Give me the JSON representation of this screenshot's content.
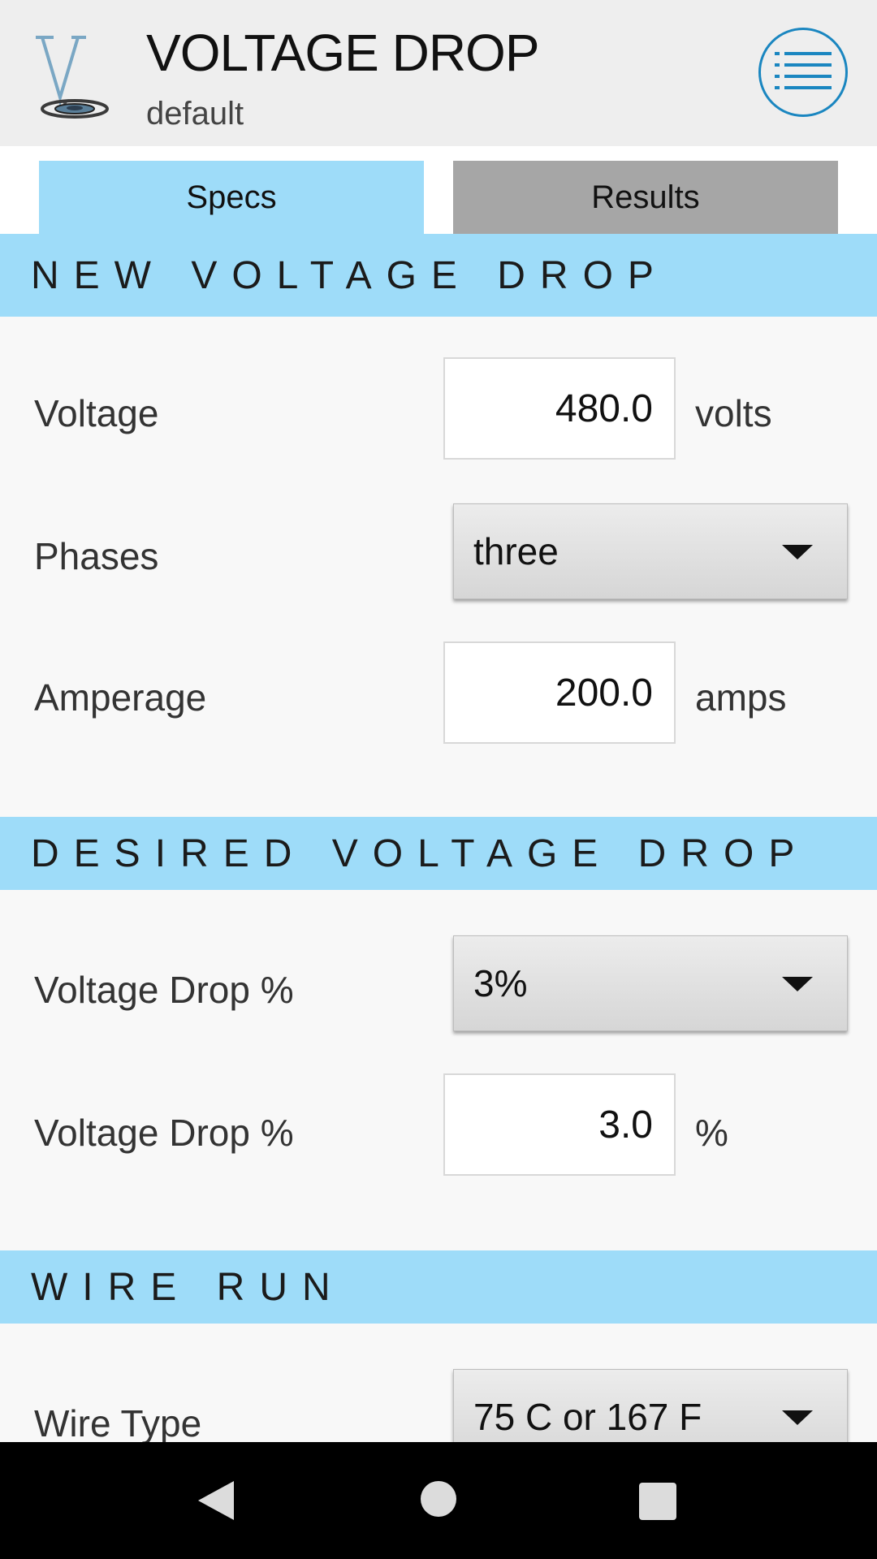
{
  "app": {
    "title": "VOLTAGE DROP",
    "subtitle": "default",
    "logo_icon": "voltage-droplet-logo",
    "menu_icon": "list-menu-icon",
    "accent_color": "#9edcf9",
    "menu_color": "#1a86c0"
  },
  "tabs": [
    {
      "label": "Specs",
      "active": true
    },
    {
      "label": "Results",
      "active": false
    }
  ],
  "sections": {
    "new_voltage_drop": {
      "heading": "NEW VOLTAGE DROP",
      "voltage": {
        "label": "Voltage",
        "value": "480.0",
        "unit": "volts"
      },
      "phases": {
        "label": "Phases",
        "selected": "three"
      },
      "amperage": {
        "label": "Amperage",
        "value": "200.0",
        "unit": "amps"
      }
    },
    "desired_voltage_drop": {
      "heading": "DESIRED VOLTAGE DROP",
      "percent_select": {
        "label": "Voltage Drop %",
        "selected": "3%"
      },
      "percent_input": {
        "label": "Voltage Drop %",
        "value": "3.0",
        "unit": "%"
      }
    },
    "wire_run": {
      "heading": "WIRE RUN",
      "wire_type": {
        "label": "Wire Type",
        "selected": "75 C or 167 F"
      }
    }
  },
  "navbar": {
    "back_icon": "back-triangle-icon",
    "home_icon": "home-circle-icon",
    "recents_icon": "recents-square-icon"
  }
}
